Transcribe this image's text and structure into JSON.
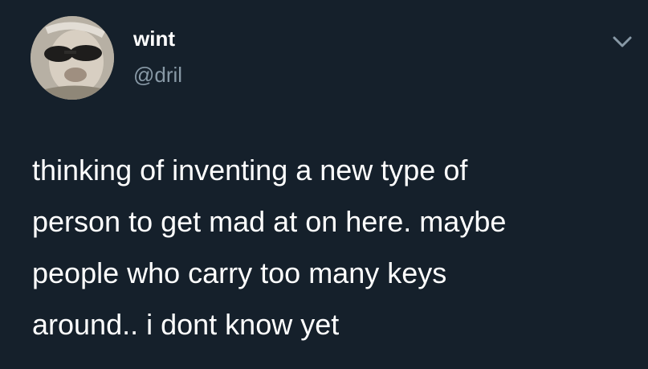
{
  "author": {
    "display_name": "wint",
    "handle": "@dril"
  },
  "icons": {
    "avatar": "avatar-image",
    "menu": "chevron-down-icon"
  },
  "tweet": {
    "lines": [
      "thinking of inventing a new type of",
      "person to get mad at on here. maybe",
      "people who carry too many keys",
      "around.. i dont know yet"
    ]
  },
  "colors": {
    "background": "#15202b",
    "text": "#ffffff",
    "secondary_text": "#8899a6"
  }
}
